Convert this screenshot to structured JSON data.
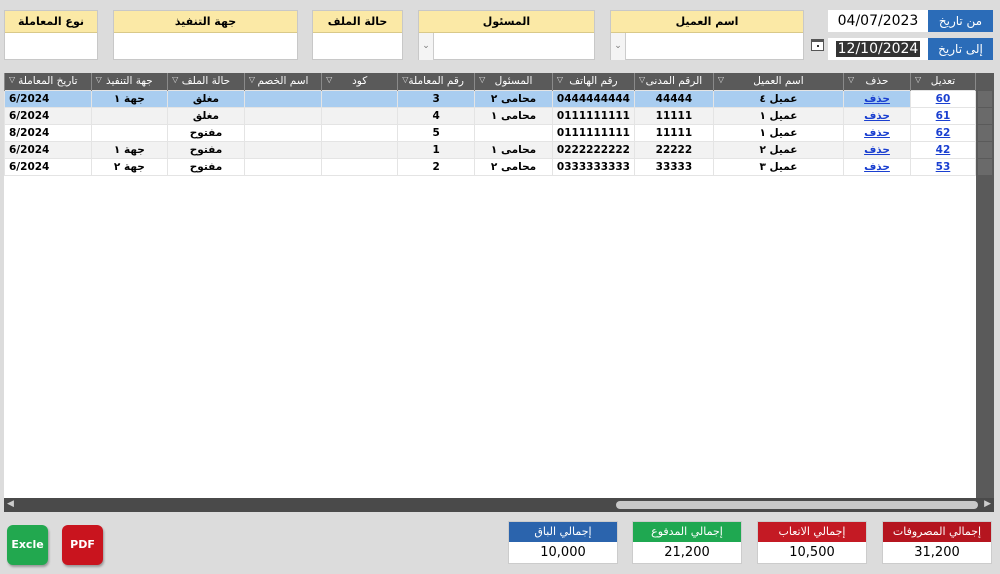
{
  "filters": {
    "transaction_type": {
      "label": "نوع المعاملة",
      "value": ""
    },
    "executing_body": {
      "label": "جهة التنفيذ",
      "value": ""
    },
    "file_status": {
      "label": "حالة الملف",
      "value": ""
    },
    "responsible": {
      "label": "المسئول",
      "value": ""
    },
    "client_name": {
      "label": "اسم العميل",
      "value": ""
    },
    "from_date": {
      "label": "من تاريخ",
      "value": "04/07/2023"
    },
    "to_date": {
      "label": "إلى تاريخ",
      "value": "12/10/2024"
    }
  },
  "table": {
    "headers": [
      "تعديل",
      "حذف",
      "اسم العميل",
      "الرقم المدنى",
      "رقم الهاتف",
      "المسئول",
      "رقم المعاملة",
      "كود",
      "اسم الخصم",
      "حالة الملف",
      "جهة التنفيذ",
      "تاريخ المعاملة"
    ],
    "rows": [
      {
        "edit": "60",
        "delete": "حذف",
        "client": "عميل ٤",
        "civil_id": "44444",
        "phone": "0444444444",
        "responsible": "محامى ٢",
        "txn_no": "3",
        "code": "",
        "opponent": "",
        "status": "مغلق",
        "body": "جهة ١",
        "date": "6/2024"
      },
      {
        "edit": "61",
        "delete": "حذف",
        "client": "عميل ١",
        "civil_id": "11111",
        "phone": "0111111111",
        "responsible": "محامى ١",
        "txn_no": "4",
        "code": "",
        "opponent": "",
        "status": "مغلق",
        "body": "",
        "date": "6/2024"
      },
      {
        "edit": "62",
        "delete": "حذف",
        "client": "عميل ١",
        "civil_id": "11111",
        "phone": "0111111111",
        "responsible": "",
        "txn_no": "5",
        "code": "",
        "opponent": "",
        "status": "مفتوح",
        "body": "",
        "date": "8/2024"
      },
      {
        "edit": "42",
        "delete": "حذف",
        "client": "عميل ٢",
        "civil_id": "22222",
        "phone": "0222222222",
        "responsible": "محامى ١",
        "txn_no": "1",
        "code": "",
        "opponent": "",
        "status": "مفتوح",
        "body": "جهة ١",
        "date": "6/2024"
      },
      {
        "edit": "53",
        "delete": "حذف",
        "client": "عميل ٣",
        "civil_id": "33333",
        "phone": "0333333333",
        "responsible": "محامى ٢",
        "txn_no": "2",
        "code": "",
        "opponent": "",
        "status": "مفتوح",
        "body": "جهة ٢",
        "date": "6/2024"
      }
    ]
  },
  "buttons": {
    "excel": "Excle",
    "pdf": "PDF"
  },
  "totals": [
    {
      "label": "إجمالي الباق",
      "value": "10,000",
      "color": "#2b64ad"
    },
    {
      "label": "إجمالي المدفوع",
      "value": "21,200",
      "color": "#1fa851"
    },
    {
      "label": "إجمالي الاتعاب",
      "value": "10,500",
      "color": "#c41a24"
    },
    {
      "label": "إجمالي المصروفات",
      "value": "31,200",
      "color": "#b5151f"
    }
  ]
}
